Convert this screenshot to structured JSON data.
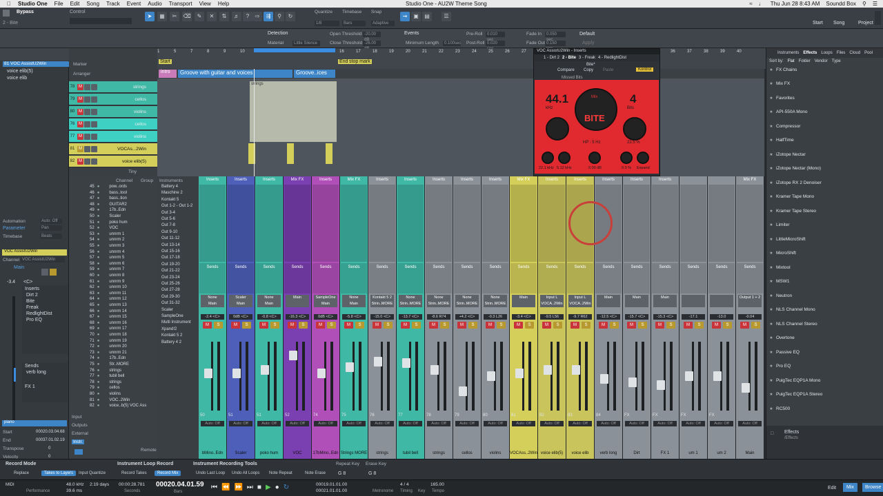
{
  "macbar": {
    "app": "Studio One",
    "menus": [
      "File",
      "Edit",
      "Song",
      "Track",
      "Event",
      "Audio",
      "Transport",
      "View",
      "Help"
    ],
    "title": "Studio One - AU2W Theme Song",
    "clock": "Thu Jun 28  8:43 AM",
    "user": "Soundd Box"
  },
  "toolbar": {
    "preset": "Bypass",
    "sub": "2 - Bite",
    "control_label": "Control",
    "quantize_label": "Quantize",
    "quantize": "1/8",
    "timebase_label": "Timebase",
    "timebase": "Bars",
    "snap_label": "Snap",
    "snap": "Adaptive",
    "start": "Start",
    "song": "Song",
    "project": "Project"
  },
  "infobar": {
    "detection": "Detection",
    "material": "Material",
    "material_val": "Little Silence",
    "open_th": "Open Threshold",
    "close_th": "Close Threshold",
    "open_val": "-20.00 dB",
    "close_val": "-26.00 dB",
    "events": "Events",
    "min_len": "Minimum Length",
    "min_len_val": "0.100sec",
    "preroll": "Pre-Roll",
    "preroll_val": "0.010 sec",
    "postroll": "Post-Roll",
    "postroll_val": "0.020 sec",
    "fadein": "Fade In",
    "fadein_val": "0.050 sec",
    "fadeout": "Fade Out",
    "fadeout_val": "0.150 sec",
    "default": "Default",
    "apply": "Apply"
  },
  "inspector": {
    "track_num": "81",
    "track_name": "VOC AssistU2Win",
    "items": [
      "voice elib(5)",
      "voice elib"
    ],
    "automation": "Automation",
    "auto_off": "Auto: Off",
    "parameter": "Parameter",
    "pan": "Pan",
    "timebase": "Timebase",
    "beats": "Beats",
    "channel_name": "VOC AssistU2Win",
    "channel": "Channel",
    "channel_val": "VOC AssistU2Win",
    "main": "Main",
    "vol": "-3.4",
    "pan_val": "<C>",
    "inserts": "Inserts",
    "insert_items": [
      "Dirt 2",
      "Bite",
      "Freak",
      "RedlightDist",
      "Pro EQ"
    ],
    "sends": "Sends",
    "send_items": [
      "verb long"
    ],
    "fx": "FX 1",
    "piano": "piano",
    "start": "Start",
    "start_val": "00020.03.04.68",
    "end": "End",
    "end_val": "00037.01.02.19",
    "transpose": "Transpose",
    "transpose_val": "0",
    "velocity": "Velocity",
    "velocity_val": "0"
  },
  "tracklist": {
    "marker": "Marker",
    "arranger": "Arranger",
    "tracks": [
      {
        "n": "78",
        "name": "strings"
      },
      {
        "n": "79",
        "name": "cellos"
      },
      {
        "n": "80",
        "name": "violins"
      },
      {
        "n": "76",
        "name": "cellos"
      },
      {
        "n": "77",
        "name": "violins"
      },
      {
        "n": "81",
        "name": "VOCAs...2Win"
      },
      {
        "n": "82",
        "name": "voice elib(5)"
      }
    ],
    "tiny": "Tiny"
  },
  "ruler": {
    "bars": [
      "1",
      "5",
      "7",
      "8",
      "9",
      "10",
      "11",
      "12",
      "13",
      "14",
      "15",
      "16",
      "17",
      "18",
      "19",
      "20",
      "21",
      "22",
      "23",
      "24",
      "25",
      "26",
      "27",
      "28",
      "29",
      "30",
      "31",
      "32",
      "33",
      "34",
      "35",
      "36",
      "37",
      "38",
      "39",
      "40"
    ],
    "start": "Start",
    "end": "End",
    "stop": "stop mark"
  },
  "arrange": {
    "intro": "intro",
    "section1": "Groove with guitar and voices",
    "section2": "Groove..ices",
    "clip": "strings"
  },
  "plugin": {
    "title": "VOC AssistU2Win - Inserts",
    "slots": [
      "1 - Dirt 2",
      "2 - Bite",
      "3 - Freak",
      "4 - RedlightDist"
    ],
    "preset": "Bite*",
    "compare": "Compare",
    "copy": "Copy",
    "paste": "Paste",
    "kontrol": "Kontrol",
    "preset2": "Missed Bits",
    "khz": "44.1",
    "khz_unit": "kHz",
    "bits": "4",
    "bits_unit": "Bits",
    "logo": "BITE",
    "mix": "Mix",
    "hp": "HP : 5 Hz",
    "pct": "22.5 %",
    "knob_vals": [
      "22.1 kHz",
      "5.12 kHz",
      "0.00 dB",
      "0.0 %",
      "Expand"
    ]
  },
  "chanlist": {
    "cols": [
      "Channel",
      "Group"
    ],
    "rows": [
      {
        "n": "45",
        "name": "pow..ords"
      },
      {
        "n": "46",
        "name": "bass..tool"
      },
      {
        "n": "47",
        "name": "bass..tion"
      },
      {
        "n": "48",
        "name": "GUITAR2"
      },
      {
        "n": "49",
        "name": "17b..Edn"
      },
      {
        "n": "50",
        "name": "Scaler"
      },
      {
        "n": "51",
        "name": "poko hum"
      },
      {
        "n": "52",
        "name": "VOC"
      },
      {
        "n": "53",
        "name": "unnrm 1"
      },
      {
        "n": "54",
        "name": "unnrm 2"
      },
      {
        "n": "55",
        "name": "unnrm 3"
      },
      {
        "n": "56",
        "name": "unnrm 4"
      },
      {
        "n": "57",
        "name": "unnrm 5"
      },
      {
        "n": "58",
        "name": "unnrm 6"
      },
      {
        "n": "59",
        "name": "unnrm 7"
      },
      {
        "n": "60",
        "name": "unnrm 8"
      },
      {
        "n": "61",
        "name": "unnrm 9"
      },
      {
        "n": "62",
        "name": "unnrm 10"
      },
      {
        "n": "63",
        "name": "unnrm 11"
      },
      {
        "n": "64",
        "name": "unnrm 12"
      },
      {
        "n": "65",
        "name": "unnrm 13"
      },
      {
        "n": "66",
        "name": "unnrm 14"
      },
      {
        "n": "67",
        "name": "unnrm 15"
      },
      {
        "n": "68",
        "name": "unnrm 16"
      },
      {
        "n": "69",
        "name": "unnrm 17"
      },
      {
        "n": "70",
        "name": "unnrm 18"
      },
      {
        "n": "71",
        "name": "unnrm 19"
      },
      {
        "n": "72",
        "name": "unnrm 20"
      },
      {
        "n": "73",
        "name": "unnrm 21"
      },
      {
        "n": "74",
        "name": "17b..Edn"
      },
      {
        "n": "75",
        "name": "Str..MORE"
      },
      {
        "n": "76",
        "name": "strings"
      },
      {
        "n": "77",
        "name": "tubil bell"
      },
      {
        "n": "78",
        "name": "strings"
      },
      {
        "n": "79",
        "name": "cellos"
      },
      {
        "n": "80",
        "name": "violins"
      },
      {
        "n": "81",
        "name": "VOC..2Win"
      },
      {
        "n": "82",
        "name": "voice..b(5) VOC Ass"
      }
    ],
    "input": "Input",
    "outputs": "Outputs",
    "external": "External",
    "instr": "Instr.",
    "remote": "Remote"
  },
  "instlist": {
    "title": "Instruments",
    "items": [
      "Battery 4",
      "Maschine 2",
      "Kontakt 5",
      "Out 1-2 - Out 1-2",
      "Out 3-4",
      "Out 5-6",
      "Out 7-8",
      "Out 9-10",
      "Out 11-12",
      "Out 13-14",
      "Out 15-16",
      "Out 17-18",
      "Out 19-20",
      "Out 21-22",
      "Out 23-24",
      "Out 25-26",
      "Out 27-28",
      "Out 29-30",
      "Out 31-32",
      "Scaler",
      "SampleOne",
      "Multi Instrument",
      "Xpand!2",
      "Kontakt 5 2",
      "Battery 4 2"
    ]
  },
  "mixer": {
    "strips": [
      {
        "hdr": "Inserts",
        "io1": "None",
        "io2": "Main",
        "pan": "<C>",
        "vol": "-2.4",
        "num": "50",
        "name": "bMino..Edn",
        "color": "#3fb8a6",
        "cap": 0.55
      },
      {
        "hdr": "Inserts",
        "io1": "Scaler",
        "io2": "Main",
        "pan": "<C>",
        "vol": "0dB",
        "num": "51",
        "name": "Scaler",
        "color": "#4d5fb8",
        "cap": 0.55
      },
      {
        "hdr": "Inserts",
        "io1": "None",
        "io2": "Main",
        "pan": "<C>",
        "vol": "-0.8",
        "num": "51",
        "name": "poko hum",
        "color": "#3fb8a6",
        "cap": 0.6
      },
      {
        "hdr": "Mix FX",
        "io1": "",
        "io2": "Main",
        "pan": "<C>",
        "vol": "-16.3",
        "num": "52",
        "name": "VOC",
        "color": "#7a3fb0",
        "cap": 0.85
      },
      {
        "hdr": "Inserts",
        "io1": "SampleOne",
        "io2": "Main",
        "pan": "<C>",
        "vol": "0dB",
        "num": "74",
        "name": "17bMino..Edn",
        "color": "#b04fb8",
        "cap": 0.55
      },
      {
        "hdr": "Mix FX",
        "io1": "None",
        "io2": "Main",
        "pan": "<C>",
        "vol": "-5.8",
        "num": "75",
        "name": "Strings MORE",
        "color": "#3fb8a6",
        "cap": 0.65
      },
      {
        "hdr": "Inserts",
        "io1": "Kontakt 5 2",
        "io2": "Strin..MORE",
        "pan": "<C>",
        "vol": "-15.0",
        "num": "76",
        "name": "strings",
        "color": "#8a9198",
        "cap": 0.75
      },
      {
        "hdr": "Inserts",
        "io1": "None",
        "io2": "Strin..MORE",
        "pan": "<C>",
        "vol": "-13.7",
        "num": "77",
        "name": "tubil bell",
        "color": "#3fb8a6",
        "cap": 0.72
      },
      {
        "hdr": "Inserts",
        "io1": "None",
        "io2": "Strin..MORE",
        "pan": "R74",
        "vol": "-8.6",
        "num": "78",
        "name": "strings",
        "color": "#8a9198",
        "cap": 0.6
      },
      {
        "hdr": "Inserts",
        "io1": "None",
        "io2": "Strin..MORE",
        "pan": "<C>",
        "vol": "+4.2",
        "num": "79",
        "name": "cellos",
        "color": "#8a9198",
        "cap": 0.25
      },
      {
        "hdr": "Inserts",
        "io1": "None",
        "io2": "Strin..MORE",
        "pan": "L26",
        "vol": "-0.3",
        "num": "80",
        "name": "violins",
        "color": "#8a9198",
        "cap": 0.5
      },
      {
        "hdr": "Mix FX",
        "io1": "",
        "io2": "Main",
        "pan": "<C>",
        "vol": "-3.4",
        "num": "81",
        "name": "VOCAss..2Win",
        "color": "#d4cf5a",
        "cap": 0.55
      },
      {
        "hdr": "Inserts",
        "io1": "Input L",
        "io2": "VOCA..2Win",
        "pan": "L56",
        "vol": "-9.5",
        "num": "82",
        "name": "voice elib(5)",
        "color": "#c9c45c",
        "cap": 0.6
      },
      {
        "hdr": "Inserts",
        "io1": "Input L",
        "io2": "VOCA..2Win",
        "pan": "R62",
        "vol": "-9.7",
        "num": "83",
        "name": "voice elib",
        "color": "#c9c45c",
        "cap": 0.6
      },
      {
        "hdr": "Inserts",
        "io1": "",
        "io2": "Main",
        "pan": "<C>",
        "vol": "-12.5",
        "num": "84",
        "name": "verb long",
        "color": "#8a9198",
        "cap": 0.45
      },
      {
        "hdr": "Inserts",
        "io1": "",
        "io2": "Main",
        "pan": "<C>",
        "vol": "-15.7",
        "num": "FX",
        "name": "Dirt",
        "color": "#8a9198",
        "cap": 0.4
      },
      {
        "hdr": "Inserts",
        "io1": "",
        "io2": "Main",
        "pan": "<C>",
        "vol": "-15.3",
        "num": "FX",
        "name": "FX 1",
        "color": "#8a9198",
        "cap": 0.35
      },
      {
        "hdr": "",
        "io1": "",
        "io2": "",
        "pan": "",
        "vol": "-17.1",
        "num": "FX",
        "name": "um 1",
        "color": "#8a9198",
        "cap": 0.5
      },
      {
        "hdr": "",
        "io1": "",
        "io2": "",
        "pan": "",
        "vol": "-13.0",
        "num": "FX",
        "name": "um 2",
        "color": "#8a9198",
        "cap": 0.5
      },
      {
        "hdr": "Mix FX",
        "io1": "Output 1 + 2",
        "io2": "",
        "pan": "",
        "vol": "-0.04",
        "num": "",
        "name": "Main",
        "color": "#8a9198",
        "cap": 0.3
      }
    ],
    "circle_note": ""
  },
  "browser": {
    "tabs": [
      "Instruments",
      "Effects",
      "Loops",
      "Files",
      "Cloud",
      "Pool"
    ],
    "sort": "Sort by:",
    "sorts": [
      "Flat",
      "Folder",
      "Vendor",
      "Type"
    ],
    "items": [
      "FX Chains",
      "Mix FX",
      "Favorites",
      "API-550A Mono",
      "Compressor",
      "HalfTime",
      "iZotope Nectar",
      "iZotope Nectar (Mono)",
      "iZotope RX 2 Denoiser",
      "Kramer Tape Mono",
      "Kramer Tape Stereo",
      "Limiter",
      "LittleMicroShift",
      "MicroShift",
      "Mixtool",
      "MSW1",
      "Neutron",
      "NLS Channel Mono",
      "NLS Channel Stereo",
      "Overtone",
      "Passive EQ",
      "Pro EQ",
      "PuigTec EQP1A Mono",
      "PuigTec EQP1A Stereo",
      "RC500"
    ],
    "footer": "Effects",
    "footer_sub": "/Effects"
  },
  "bottom": {
    "record_mode": "Record Mode",
    "replace": "Replace",
    "takes": "Takes to Layers",
    "input_q": "Input Quantize",
    "loop_record": "Instrument Loop Record",
    "record_takes": "Record Takes",
    "record_mix": "Record Mix",
    "loop_tools": "Instrument Recording Tools",
    "undo_last": "Undo Last Loop",
    "undo_all": "Undo All Loops",
    "note_repeat": "Note Repeat",
    "note_erase": "Note Erase",
    "repeat_key": "Repeat Key",
    "repeat_val": "G 8",
    "erase_key": "Erase Key",
    "erase_val": "G 8"
  },
  "transport": {
    "midi": "MIDI",
    "perf": "Performance",
    "rate": "48.0 kHz",
    "rec_max": "39.6 ms",
    "days": "2:19 days",
    "time": "00:00:28.781",
    "seconds": "Seconds",
    "bars": "00020.04.01.59",
    "bars_lbl": "Bars",
    "loop1": "00019.01.01.00",
    "loop2": "00021.01.01.00",
    "sig": "4 / 4",
    "tempo": "165.00",
    "metronome": "Metronome",
    "timing": "Timing",
    "key": "Key",
    "tempo_lbl": "Tempo",
    "edit": "Edit",
    "mix": "Mix",
    "browse": "Browse"
  }
}
